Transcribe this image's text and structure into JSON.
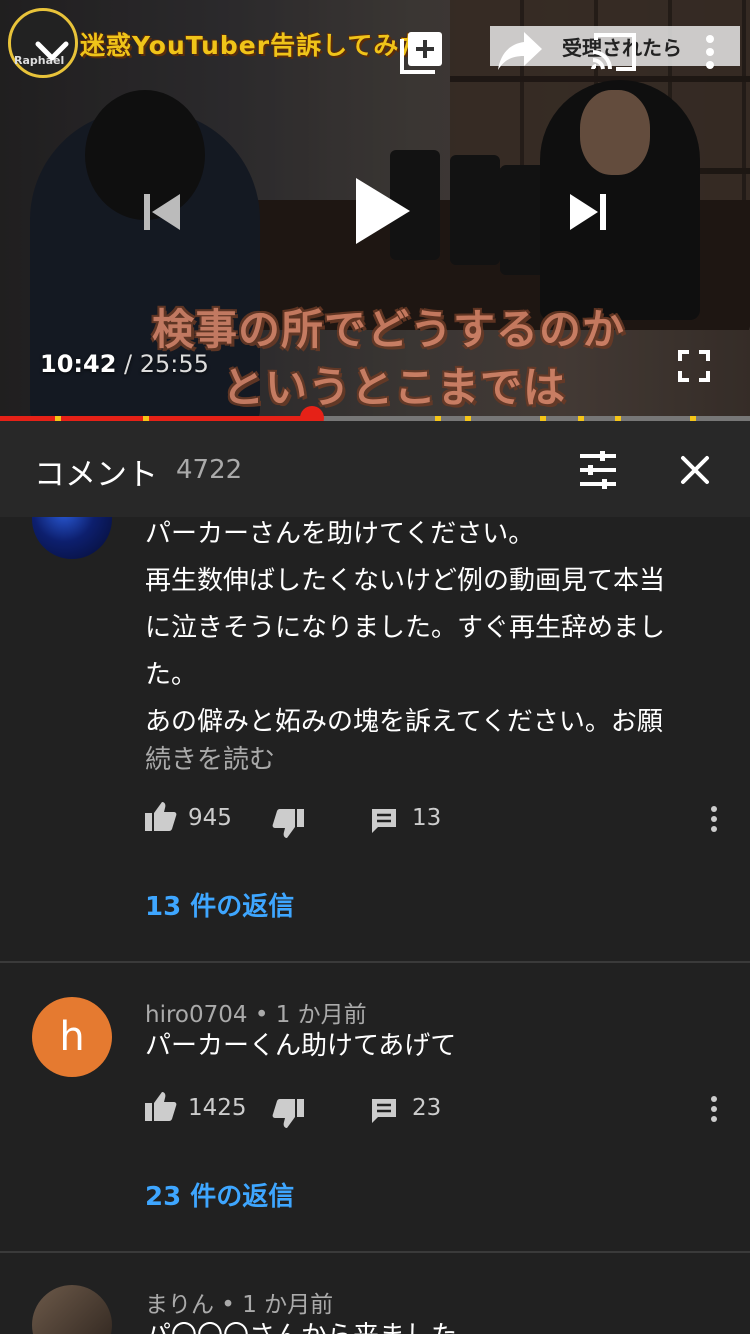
{
  "player": {
    "channel_logo_text": "Raphael",
    "video_title": "迷惑YouTuber告訴してみた！",
    "overlay_sign_text": "受理されたら",
    "subtitle_line1": "検事の所でどうするのか",
    "subtitle_line2": "というとこまでは",
    "current_time": "10:42",
    "separator": " / ",
    "duration": "25:55",
    "progress_fraction": 0.416,
    "ad_markers": [
      0.073,
      0.19,
      0.58,
      0.62,
      0.72,
      0.77,
      0.82,
      0.92
    ],
    "icons": [
      "chevron-down-icon",
      "add-to-playlist-icon",
      "share-icon",
      "cast-icon",
      "more-vert-icon",
      "skip-previous-icon",
      "play-icon",
      "skip-next-icon",
      "fullscreen-icon"
    ]
  },
  "comments_header": {
    "title": "コメント",
    "count": "4722",
    "icons": [
      "sort-filter-icon",
      "close-icon"
    ]
  },
  "comments": [
    {
      "author": "",
      "time": "",
      "body_lines": [
        "パーカーさんを助けてください。",
        "再生数伸ばしたくないけど例の動画見て本当",
        "に泣きそうになりました。すぐ再生辞めまし",
        "た。",
        "あの僻みと妬みの塊を訴えてください。お願"
      ],
      "read_more": "続きを読む",
      "likes": "945",
      "reply_count": "13",
      "replies_link": "13 件の返信"
    },
    {
      "avatar_letter": "h",
      "author": "hiro0704",
      "dot": " • ",
      "time": "1 か月前",
      "body_lines": [
        "パーカーくん助けてあげて"
      ],
      "likes": "1425",
      "reply_count": "23",
      "replies_link": "23 件の返信"
    },
    {
      "author": "まりん",
      "dot": " • ",
      "time": "1 か月前",
      "body_lines": [
        "パ〇〇〇さんから来ました"
      ]
    }
  ],
  "colors": {
    "background": "#212121",
    "header": "#282828",
    "progress_played": "#e62117",
    "progress_ad": "#f5c518",
    "link": "#3ea6ff",
    "avatar_h": "#e57a30"
  }
}
